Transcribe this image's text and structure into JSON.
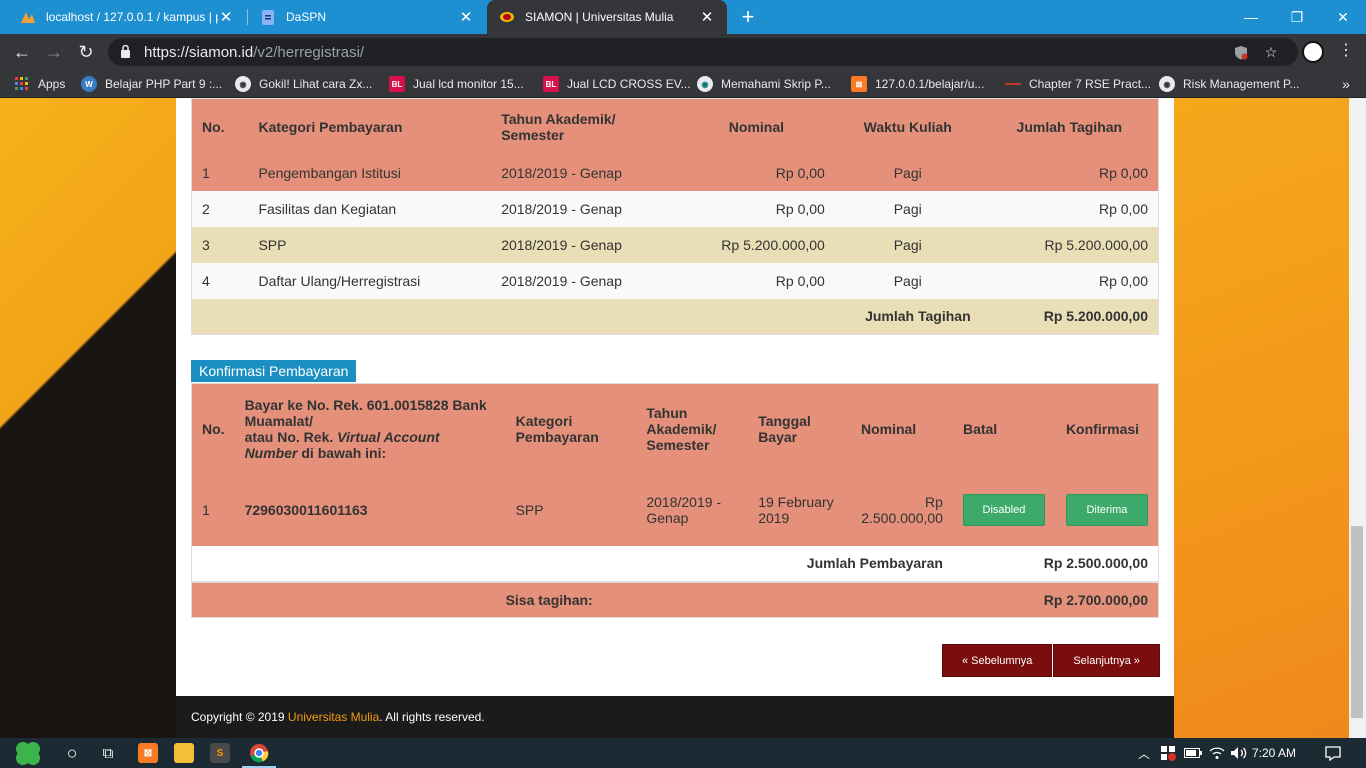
{
  "browser": {
    "tabs": [
      {
        "title": "localhost / 127.0.0.1 / kampus | p",
        "icon": "phpmyadmin-icon"
      },
      {
        "title": "DaSPN",
        "icon": "document-icon"
      },
      {
        "title": "SIAMON | Universitas Mulia",
        "icon": "siamon-icon"
      }
    ],
    "new_tab": "+",
    "url_host": "https://siamon.id",
    "url_path": "/v2/herregistrasi/",
    "bookmarks": [
      {
        "label": "Apps",
        "icon": "apps-grid-icon"
      },
      {
        "label": "Belajar PHP Part 9 :...",
        "icon": "wordpress-icon"
      },
      {
        "label": "Gokil! Lihat cara Zx...",
        "icon": "globe-icon"
      },
      {
        "label": "Jual lcd monitor 15...",
        "icon": "bl-icon"
      },
      {
        "label": "Jual LCD CROSS EV...",
        "icon": "bl-icon"
      },
      {
        "label": "Memahami Skrip P...",
        "icon": "globe-icon"
      },
      {
        "label": "127.0.0.1/belajar/u...",
        "icon": "xampp-icon"
      },
      {
        "label": "Chapter 7 RSE Pract...",
        "icon": "bookmark-icon"
      },
      {
        "label": "Risk Management P...",
        "icon": "globe-icon"
      }
    ]
  },
  "tagihan": {
    "headers": {
      "no": "No.",
      "kategori": "Kategori Pembayaran",
      "tahun": "Tahun Akademik/ Semester",
      "nominal": "Nominal",
      "waktu": "Waktu Kuliah",
      "jumlah": "Jumlah Tagihan"
    },
    "rows": [
      {
        "no": "1",
        "kategori": "Pengembangan Istitusi",
        "tahun": "2018/2019 - Genap",
        "nominal": "Rp 0,00",
        "waktu": "Pagi",
        "jumlah": "Rp 0,00"
      },
      {
        "no": "2",
        "kategori": "Fasilitas dan Kegiatan",
        "tahun": "2018/2019 - Genap",
        "nominal": "Rp 0,00",
        "waktu": "Pagi",
        "jumlah": "Rp 0,00"
      },
      {
        "no": "3",
        "kategori": "SPP",
        "tahun": "2018/2019 - Genap",
        "nominal": "Rp 5.200.000,00",
        "waktu": "Pagi",
        "jumlah": "Rp 5.200.000,00"
      },
      {
        "no": "4",
        "kategori": "Daftar Ulang/Herregistrasi",
        "tahun": "2018/2019 - Genap",
        "nominal": "Rp 0,00",
        "waktu": "Pagi",
        "jumlah": "Rp 0,00"
      }
    ],
    "total_label": "Jumlah Tagihan",
    "total_value": "Rp 5.200.000,00"
  },
  "konfirmasi": {
    "section_title": "Konfirmasi Pembayaran",
    "headers": {
      "no": "No.",
      "bayar_line1": "Bayar ke No. Rek. 601.0015828 Bank Muamalat/",
      "bayar_line2_a": "atau No. Rek. ",
      "bayar_line2_b": "Virtual Account Number",
      "bayar_line2_c": " di bawah ini:",
      "kategori": "Kategori Pembayaran",
      "tahun": "Tahun Akademik/ Semester",
      "tanggal": "Tanggal Bayar",
      "nominal": "Nominal",
      "batal": "Batal",
      "konfirmasi": "Konfirmasi"
    },
    "rows": [
      {
        "no": "1",
        "va_number": "7296030011601163",
        "kategori": "SPP",
        "tahun": "2018/2019 - Genap",
        "tanggal": "19 February 2019",
        "nominal": "Rp 2.500.000,00",
        "batal_btn": "Disabled",
        "konfirmasi_btn": "Diterima"
      }
    ],
    "jumlah_label": "Jumlah Pembayaran",
    "jumlah_value": "Rp 2.500.000,00",
    "sisa_label": "Sisa tagihan:",
    "sisa_value": "Rp 2.700.000,00"
  },
  "pager": {
    "prev": "« Sebelumnya",
    "next": "Selanjutnya »"
  },
  "footer": {
    "prefix": "Copyright © 2019 ",
    "brand": "Universitas Mulia",
    "suffix": ". All rights reserved."
  },
  "taskbar": {
    "time": "7:20 AM"
  },
  "colors": {
    "accent_blue": "#1c8fc2",
    "salmon_row": "#e4907a",
    "beige_row": "#e9deb6",
    "green_button": "#3daa6b",
    "maroon_button": "#7a0e0e",
    "brand_orange": "#f39c12"
  }
}
